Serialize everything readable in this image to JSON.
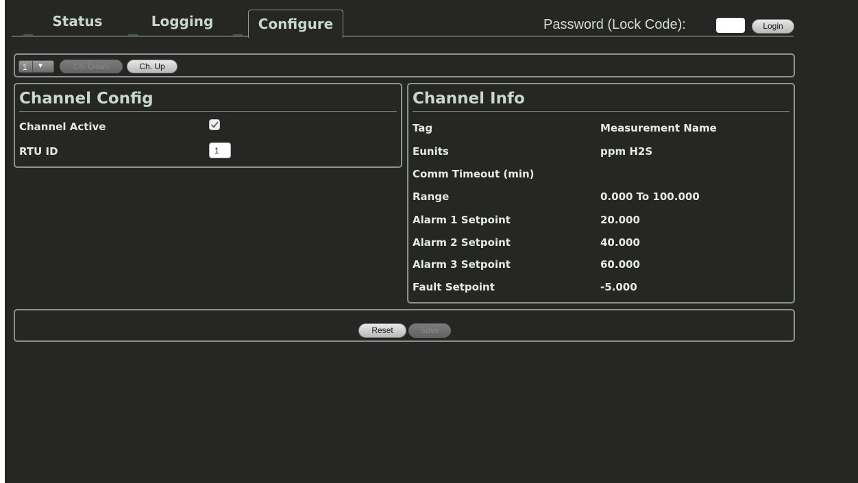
{
  "tabs": [
    {
      "label": "Status"
    },
    {
      "label": "Logging"
    },
    {
      "label": "Configure"
    }
  ],
  "active_tab": "Configure",
  "password": {
    "label": "Password (Lock Code):",
    "value": "",
    "login_label": "Login"
  },
  "toolbar": {
    "channel_selected": "1",
    "ch_down_label": "Ch. Down",
    "ch_up_label": "Ch. Up"
  },
  "channel_config": {
    "title": "Channel Config",
    "active_label": "Channel Active",
    "active_checked": true,
    "rtu_label": "RTU ID",
    "rtu_value": "1"
  },
  "channel_info": {
    "title": "Channel Info",
    "rows": [
      {
        "label": "Tag",
        "value": "Measurement Name"
      },
      {
        "label": "Eunits",
        "value": "ppm H2S"
      },
      {
        "label": "Comm Timeout (min)",
        "value": ""
      },
      {
        "label": "Range",
        "value": "0.000 To 100.000"
      },
      {
        "label": "Alarm 1 Setpoint",
        "value": "20.000"
      },
      {
        "label": "Alarm 2 Setpoint",
        "value": "40.000"
      },
      {
        "label": "Alarm 3 Setpoint",
        "value": "60.000"
      },
      {
        "label": "Fault Setpoint",
        "value": "-5.000"
      }
    ]
  },
  "footer": {
    "reset_label": "Reset",
    "save_label": "Save"
  },
  "colors": {
    "background": "#262624",
    "heading": "#c8d7cf",
    "border": "#8b9690"
  }
}
